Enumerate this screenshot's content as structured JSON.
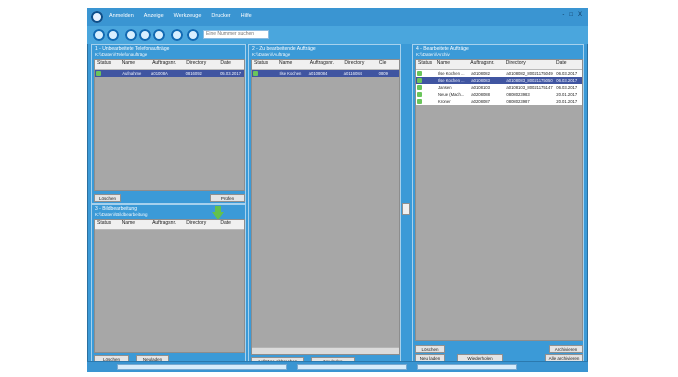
{
  "app": {
    "menu": [
      "Anmelden",
      "Anzeige",
      "Werkzeuge",
      "Drucker",
      "Hilfe"
    ],
    "window_controls": [
      "-",
      "□",
      "X"
    ]
  },
  "toolbar": {
    "search_placeholder": "Eine Nummer suchen"
  },
  "panels": {
    "left_top": {
      "title": "1 - Unbearbeitete Telefonaufträge",
      "subtitle": "K:\\\\Daten\\\\Telefonaufträge",
      "columns": [
        "Status",
        "Name",
        "Auftragsnr.",
        "Directory",
        "Date"
      ],
      "rows": [
        {
          "status": "",
          "name": "Aufnahme",
          "auftrag": "a01008A",
          "directory": "0816092",
          "date": "05.03.2017",
          "selected": true
        }
      ],
      "btn_left": "Löschen",
      "btn_right": "Prüfen"
    },
    "left_bottom": {
      "title": "3 - Bildbearbeitung",
      "subtitle": "K:\\\\Daten\\\\Bildbearbeitung",
      "columns": [
        "Status",
        "Name",
        "Auftragsnr.",
        "Directory",
        "Date"
      ],
      "btn_left": "Löschen",
      "btn_right": "Neuladen"
    },
    "middle": {
      "title": "2 - Zu bearbeitende Aufträge",
      "subtitle": "K:\\\\Daten\\\\Aufträge",
      "columns": [
        "Status",
        "Name",
        "Auftragsnr.",
        "Directory",
        "Cle"
      ],
      "rows": [
        {
          "status": "",
          "name": "Ilse Kochen",
          "auftrag": "a0108084",
          "directory": "a0116084",
          "date": "0809",
          "selected": true
        }
      ],
      "btn_left": "Aufträge abbrechen",
      "btn_right": "Neuladen"
    },
    "right": {
      "title": "4 - Bearbeitete Aufträge",
      "subtitle": "K:\\\\Daten\\\\Archiv",
      "columns": [
        "Status",
        "Name",
        "Auftragsnr.",
        "Directory",
        "Date"
      ],
      "rows": [
        {
          "name": "Ilse Kochen ...",
          "auftrag": "a0108082",
          "directory": "a0108082_80021175049",
          "date": "06.03.2017",
          "selected": false
        },
        {
          "name": "Ilse Kochen ...",
          "auftrag": "a0108083",
          "directory": "a0108083_80021175050",
          "date": "06.03.2017",
          "selected": true
        },
        {
          "name": "Jansen",
          "auftrag": "a0108103",
          "directory": "a0108103_80021175147",
          "date": "06.03.2017",
          "selected": false
        },
        {
          "name": "Neue (Mach...",
          "auftrag": "a0208088",
          "directory": "0808023983",
          "date": "20.01.2017",
          "selected": false
        },
        {
          "name": "Kroner",
          "auftrag": "a0208087",
          "directory": "0808023987",
          "date": "20.01.2017",
          "selected": false
        }
      ],
      "btn_bottom_left": "Löschen",
      "btn_bottom_right": "Archivieren",
      "btn_row2": [
        "Neu laden",
        "Wiederholen",
        "Alle archivieren"
      ]
    }
  },
  "colors": {
    "app_bg": "#3b9ad7",
    "grid_bg": "#a7a7a7",
    "selected_row": "#4055a1"
  }
}
